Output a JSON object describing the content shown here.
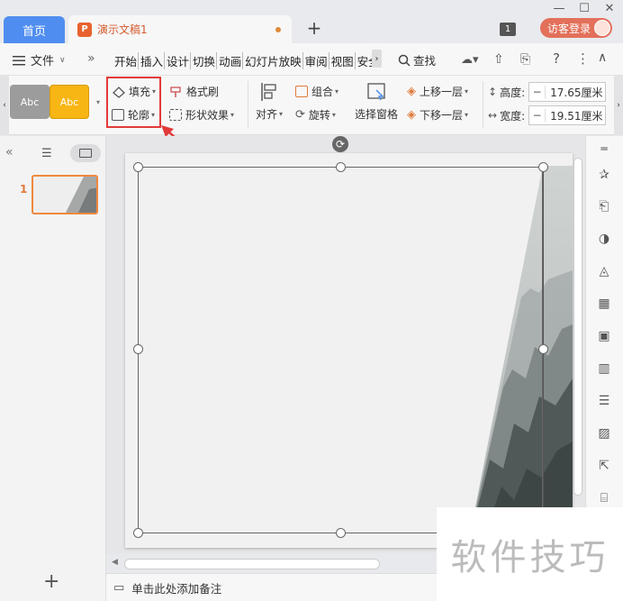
{
  "titlebar": {
    "home_tab": "首页",
    "doc_tab": "演示文稿1",
    "doc_icon": "P",
    "new_tab": "+",
    "badge": "1",
    "login": "访客登录",
    "minimize": "—",
    "maximize": "☐",
    "close": "✕"
  },
  "menubar": {
    "file": "文件",
    "more": "»",
    "items": [
      "开始",
      "插入",
      "设计",
      "切换",
      "动画",
      "幻灯片放映",
      "审阅",
      "视图",
      "安全"
    ],
    "search": "查找"
  },
  "ribbon": {
    "style1": "Abc",
    "style2": "Abc",
    "fill": "填充",
    "outline": "轮廓",
    "format_painter": "格式刷",
    "shape_effect": "形状效果",
    "align": "对齐",
    "group": "组合",
    "rotate": "旋转",
    "selection_pane": "选择窗格",
    "bring_forward": "上移一层",
    "send_backward": "下移一层",
    "height_label": "高度:",
    "height_value": "17.65厘米",
    "width_label": "宽度:",
    "width_value": "19.51厘米",
    "minus": "−"
  },
  "colors": {
    "accent": "#4f8ef0",
    "doc_orange": "#e8622f",
    "highlight": "#e23a3a",
    "login": "#e3705a",
    "style2_bg": "#f8b614"
  },
  "leftpanel": {
    "slide_number": "1",
    "add": "+",
    "collapse": "«"
  },
  "notes": {
    "placeholder": "单击此处添加备注"
  },
  "watermark": "软件技巧"
}
